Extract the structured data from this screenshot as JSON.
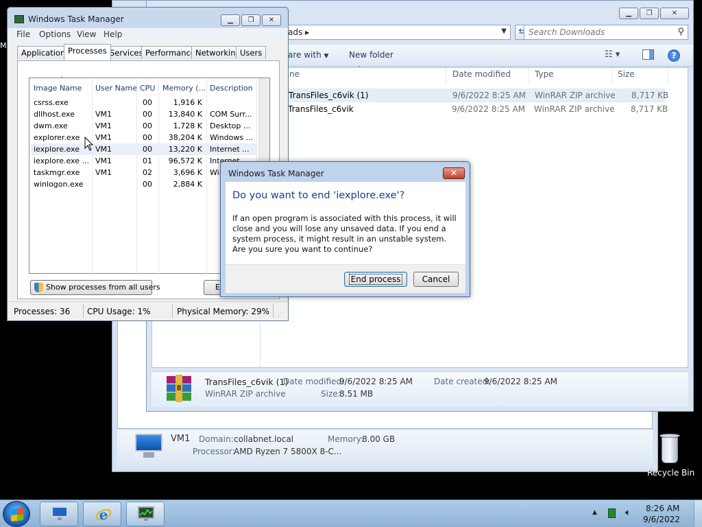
{
  "desktop": {
    "left_edge_label": "M",
    "recycle_bin": {
      "label": "Recycle Bin"
    }
  },
  "computer_window": {
    "details": {
      "name": "VM1",
      "domain_label": "Domain:",
      "domain_value": "collabnet.local",
      "memory_label": "Memory:",
      "memory_value": "8.00 GB",
      "processor_label": "Processor:",
      "processor_value": "AMD Ryzen 7 5800X 8-C..."
    }
  },
  "explorer": {
    "address_text": "ads",
    "address_separator": "▸",
    "search_placeholder": "Search Downloads",
    "command_bar": {
      "share_with": "are with",
      "new_folder": "New folder"
    },
    "columns": {
      "name": "ne",
      "date_modified": "Date modified",
      "type": "Type",
      "size": "Size"
    },
    "files": [
      {
        "name": "TransFiles_c6vik (1)",
        "date": "9/6/2022 8:25 AM",
        "type": "WinRAR ZIP archive",
        "size": "8,717 KB",
        "selected": true
      },
      {
        "name": "TransFiles_c6vik",
        "date": "9/6/2022 8:25 AM",
        "type": "WinRAR ZIP archive",
        "size": "8,717 KB",
        "selected": false
      }
    ],
    "details": {
      "name": "TransFiles_c6vik (1)",
      "date_modified_label": "Date modified:",
      "date_modified_value": "9/6/2022 8:25 AM",
      "date_created_label": "Date created:",
      "date_created_value": "9/6/2022 8:25 AM",
      "type": "WinRAR ZIP archive",
      "size_label": "Size:",
      "size_value": "8.51 MB"
    }
  },
  "task_manager": {
    "title": "Windows Task Manager",
    "menu": [
      "File",
      "Options",
      "View",
      "Help"
    ],
    "tabs": [
      "Applications",
      "Processes",
      "Services",
      "Performance",
      "Networking",
      "Users"
    ],
    "active_tab": "Processes",
    "columns": {
      "image_name": "Image Name",
      "user_name": "User Name",
      "cpu": "CPU",
      "memory": "Memory (...",
      "description": "Description"
    },
    "processes": [
      {
        "image": "csrss.exe",
        "user": "",
        "cpu": "00",
        "memory": "1,916 K",
        "description": ""
      },
      {
        "image": "dllhost.exe",
        "user": "VM1",
        "cpu": "00",
        "memory": "13,840 K",
        "description": "COM Surr..."
      },
      {
        "image": "dwm.exe",
        "user": "VM1",
        "cpu": "00",
        "memory": "1,728 K",
        "description": "Desktop ..."
      },
      {
        "image": "explorer.exe",
        "user": "VM1",
        "cpu": "00",
        "memory": "38,204 K",
        "description": "Windows ..."
      },
      {
        "image": "iexplore.exe",
        "user": "VM1",
        "cpu": "00",
        "memory": "13,220 K",
        "description": "Internet ..."
      },
      {
        "image": "iexplore.exe ...",
        "user": "VM1",
        "cpu": "01",
        "memory": "96,572 K",
        "description": "Internet ..."
      },
      {
        "image": "taskmgr.exe",
        "user": "VM1",
        "cpu": "02",
        "memory": "3,696 K",
        "description": "Win"
      },
      {
        "image": "winlogon.exe",
        "user": "",
        "cpu": "00",
        "memory": "2,884 K",
        "description": ""
      }
    ],
    "show_all_button": "Show processes from all users",
    "end_process_button_partial": "E",
    "status": {
      "processes": "Processes: 36",
      "cpu_usage": "CPU Usage: 1%",
      "physical_memory": "Physical Memory: 29%"
    }
  },
  "dialog": {
    "title": "Windows Task Manager",
    "close_glyph": "✕",
    "heading": "Do you want to end 'iexplore.exe'?",
    "message": "If an open program is associated with this process, it will close and you will lose any unsaved data. If you end a system process, it might result in an unstable system. Are you sure you want to continue?",
    "end_process_button": "End process",
    "cancel_button": "Cancel"
  },
  "taskbar": {
    "clock_time": "8:26 AM",
    "clock_date": "9/6/2022"
  }
}
